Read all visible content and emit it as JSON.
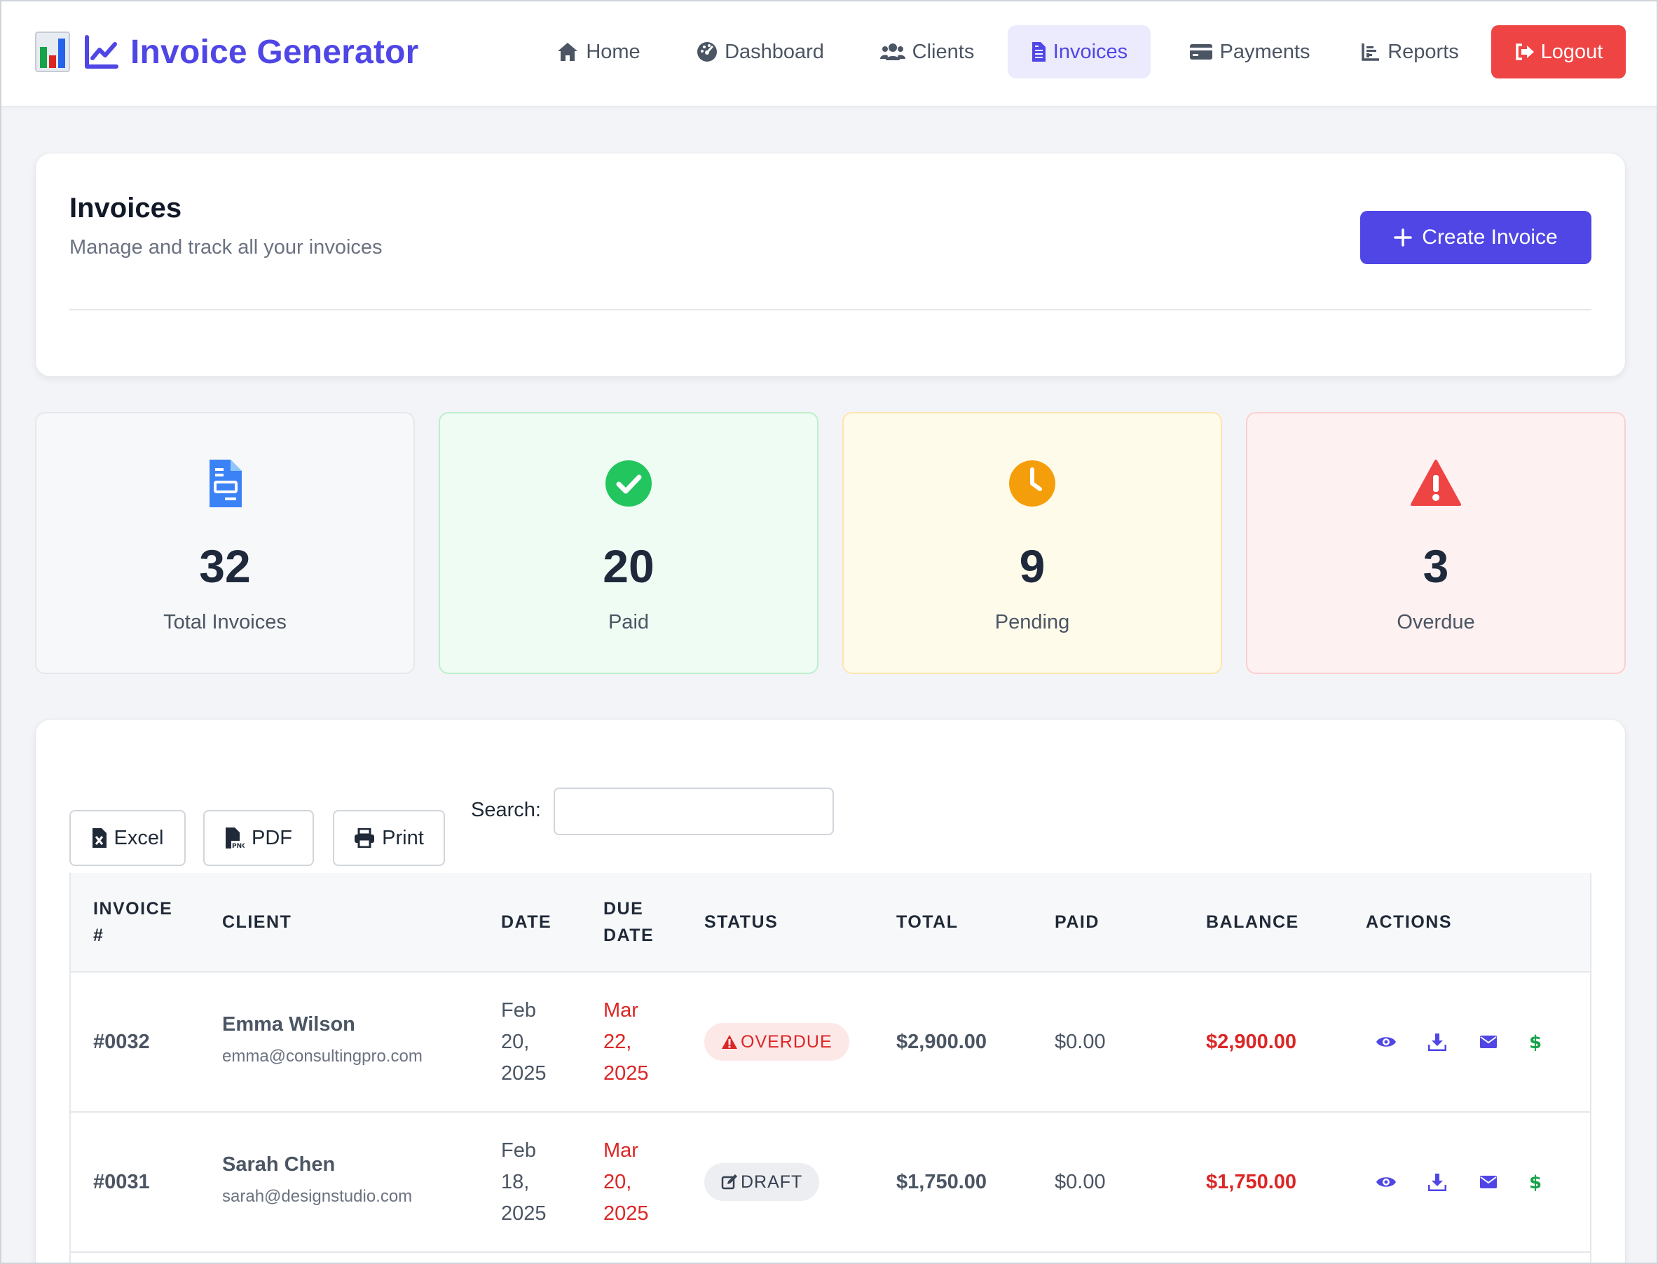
{
  "brand": {
    "title": "Invoice Generator"
  },
  "nav": {
    "items": [
      {
        "label": "Home",
        "icon": "home-icon"
      },
      {
        "label": "Dashboard",
        "icon": "gauge-icon"
      },
      {
        "label": "Clients",
        "icon": "users-icon"
      },
      {
        "label": "Invoices",
        "icon": "file-invoice-icon",
        "active": true
      },
      {
        "label": "Payments",
        "icon": "credit-card-icon"
      },
      {
        "label": "Reports",
        "icon": "chart-icon"
      }
    ],
    "logout_label": "Logout"
  },
  "header": {
    "title": "Invoices",
    "subtitle": "Manage and track all your invoices",
    "create_label": "Create Invoice"
  },
  "stats": [
    {
      "value": "32",
      "label": "Total Invoices",
      "icon": "file-icon",
      "color": "#3b82f6"
    },
    {
      "value": "20",
      "label": "Paid",
      "icon": "check-circle-icon",
      "color": "#22c55e"
    },
    {
      "value": "9",
      "label": "Pending",
      "icon": "clock-icon",
      "color": "#f59e0b"
    },
    {
      "value": "3",
      "label": "Overdue",
      "icon": "warning-icon",
      "color": "#ef4444"
    }
  ],
  "toolbar": {
    "excel_label": "Excel",
    "pdf_label": "PDF",
    "print_label": "Print",
    "search_label": "Search:",
    "search_value": ""
  },
  "table": {
    "headers": {
      "invoice_1": "INVOICE",
      "invoice_2": "#",
      "client": "CLIENT",
      "date": "DATE",
      "due_1": "DUE",
      "due_2": "DATE",
      "status": "STATUS",
      "total": "TOTAL",
      "paid": "PAID",
      "balance": "BALANCE",
      "actions": "ACTIONS"
    },
    "rows": [
      {
        "invoice": "#0032",
        "client_name": "Emma Wilson",
        "client_email": "emma@consultingpro.com",
        "date_1": "Feb",
        "date_2": "20,",
        "date_3": "2025",
        "due_1": "Mar",
        "due_2": "22,",
        "due_3": "2025",
        "status": "OVERDUE",
        "total": "$2,900.00",
        "paid": "$0.00",
        "balance": "$2,900.00"
      },
      {
        "invoice": "#0031",
        "client_name": "Sarah Chen",
        "client_email": "sarah@designstudio.com",
        "date_1": "Feb",
        "date_2": "18,",
        "date_3": "2025",
        "due_1": "Mar",
        "due_2": "20,",
        "due_3": "2025",
        "status": "DRAFT",
        "total": "$1,750.00",
        "paid": "$0.00",
        "balance": "$1,750.00"
      }
    ]
  },
  "colors": {
    "accent": "#4f46e5",
    "danger": "#ef4444",
    "success": "#22c55e",
    "warning": "#f59e0b"
  }
}
